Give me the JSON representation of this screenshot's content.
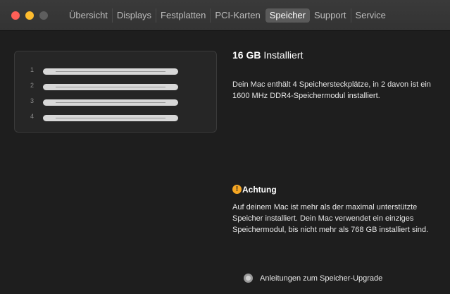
{
  "window": {
    "tabs": [
      "Übersicht",
      "Displays",
      "Festplatten",
      "PCI-Karten",
      "Speicher",
      "Support",
      "Service"
    ],
    "active_tab": "Speicher"
  },
  "memory": {
    "slots": [
      "1",
      "2",
      "3",
      "4"
    ],
    "size": "16 GB",
    "size_suffix": "Installiert",
    "description": "Dein Mac enthält 4 Speichersteckplätze, in 2 davon ist ein 1600 MHz DDR4-Speichermodul installiert."
  },
  "warning": {
    "icon": "warning-icon",
    "title": "Achtung",
    "text": "Auf deinem Mac ist mehr als der maximal unterstützte Speicher installiert. Dein Mac verwendet ein einziges Speichermodul, bis nicht mehr als 768 GB installiert sind."
  },
  "help_link": {
    "label": "Anleitungen zum Speicher-Upgrade"
  },
  "colors": {
    "close": "#ff5f57",
    "minimize": "#febc2e",
    "warning": "#f5a623"
  }
}
